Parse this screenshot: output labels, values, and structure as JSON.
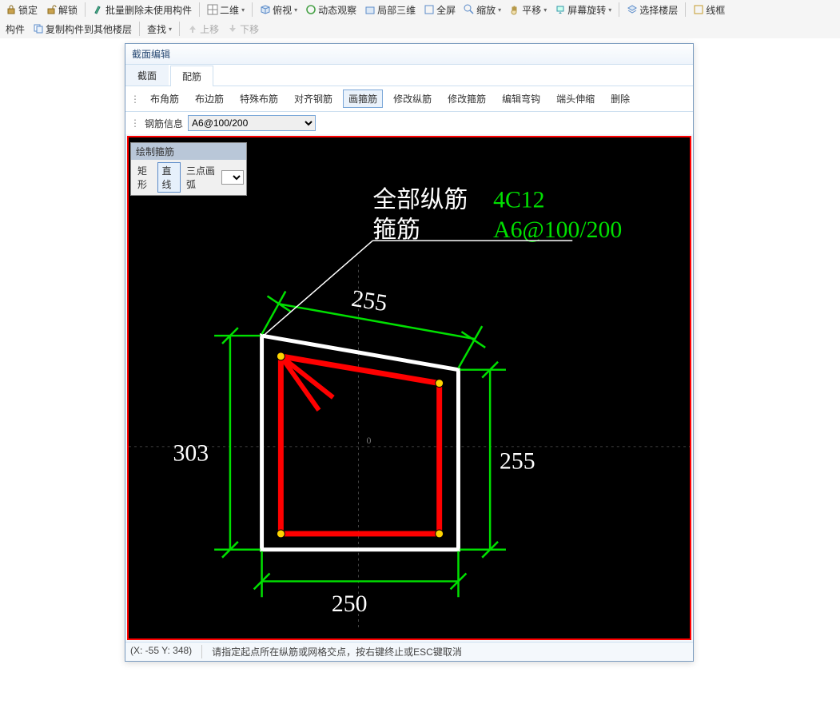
{
  "toolbar1": {
    "lock": "锁定",
    "unlock": "解锁",
    "batch_delete": "批量删除未使用构件",
    "view2d": "二维",
    "view_look": "俯视",
    "dynamic": "动态观察",
    "local3d": "局部三维",
    "fullscreen": "全屏",
    "zoom": "缩放",
    "pan": "平移",
    "rotate_screen": "屏幕旋转",
    "select_floor": "选择楼层",
    "wireframe": "线框"
  },
  "toolbar2": {
    "member": "构件",
    "copy_member": "复制构件到其他楼层",
    "find": "查找",
    "move_up": "上移",
    "move_down": "下移"
  },
  "dialog": {
    "title": "截面编辑",
    "tabs": {
      "section": "截面",
      "rebar": "配筋"
    },
    "sub": {
      "corner": "布角筋",
      "edge": "布边筋",
      "special": "特殊布筋",
      "align": "对齐钢筋",
      "draw_stirrup": "画箍筋",
      "mod_long": "修改纵筋",
      "mod_stirrup": "修改箍筋",
      "edit_hook": "编辑弯钩",
      "end_ext": "端头伸缩",
      "delete": "删除"
    },
    "info_label": "钢筋信息",
    "info_value": "A6@100/200"
  },
  "palette": {
    "title": "绘制箍筋",
    "rect": "矩形",
    "line": "直线",
    "arc3": "三点画弧"
  },
  "drawing": {
    "label_all_long": "全部纵筋",
    "label_stirrup": "箍筋",
    "val_long": "4C12",
    "val_stirrup": "A6@100/200",
    "dim_top": "255",
    "dim_right": "255",
    "dim_left": "303",
    "dim_bottom": "250",
    "origin_label": "0"
  },
  "status": {
    "coords": "(X: -55 Y: 348)",
    "hint": "请指定起点所在纵筋或网格交点，按右键终止或ESC键取消"
  }
}
